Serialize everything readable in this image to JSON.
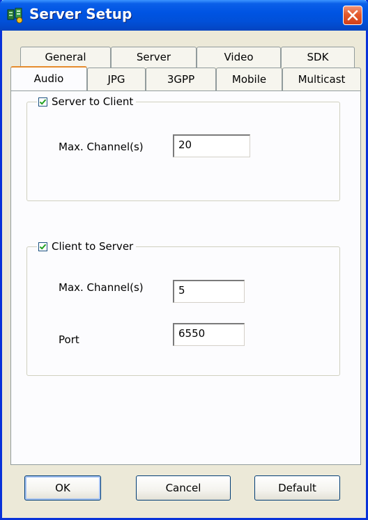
{
  "window": {
    "title": "Server Setup",
    "app_icon": "server-setup-icon",
    "close_icon": "close-icon"
  },
  "tabs": {
    "row1": [
      "General",
      "Server",
      "Video",
      "SDK"
    ],
    "row2": [
      "Audio",
      "JPG",
      "3GPP",
      "Mobile",
      "Multicast"
    ],
    "active": "Audio"
  },
  "server_to_client": {
    "label": "Server to Client",
    "checked": true,
    "max_channels_label": "Max. Channel(s)",
    "max_channels_value": "20"
  },
  "client_to_server": {
    "label": "Client to Server",
    "checked": true,
    "max_channels_label": "Max. Channel(s)",
    "max_channels_value": "5",
    "port_label": "Port",
    "port_value": "6550"
  },
  "buttons": {
    "ok": "OK",
    "cancel": "Cancel",
    "default": "Default"
  },
  "colors": {
    "titlebar": "#0054e3",
    "dialog_bg": "#ece9d8",
    "active_tab_accent": "#e68b2c",
    "close_button": "#e45a2c"
  }
}
